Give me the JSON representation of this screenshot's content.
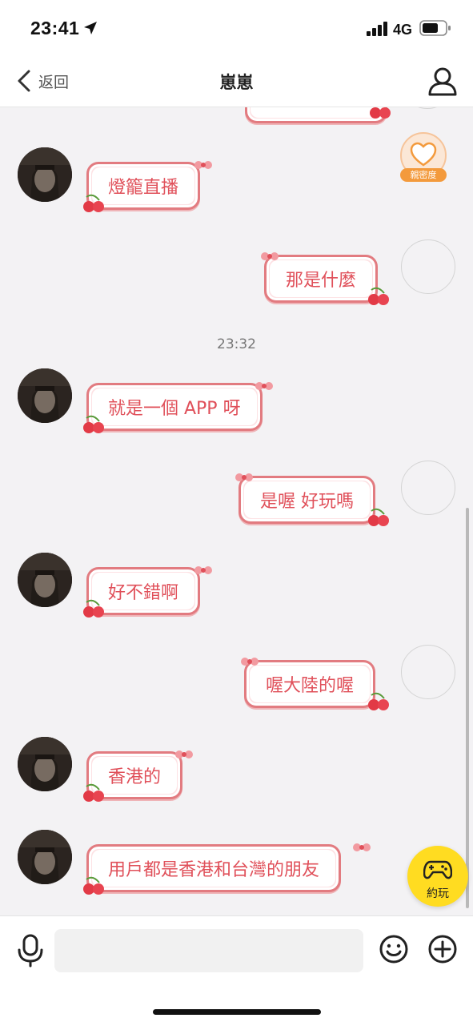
{
  "status": {
    "time": "23:41",
    "network": "4G"
  },
  "nav": {
    "back_label": "返回",
    "title": "崽崽"
  },
  "intimacy": {
    "label": "親密度"
  },
  "messages": [
    {
      "side": "left",
      "text": "燈籠直播"
    },
    {
      "side": "right",
      "text": "那是什麼"
    },
    {
      "side": "left",
      "text": "就是一個 APP 呀"
    },
    {
      "side": "right",
      "text": "是喔 好玩嗎"
    },
    {
      "side": "left",
      "text": "好不錯啊"
    },
    {
      "side": "right",
      "text": "喔大陸的喔"
    },
    {
      "side": "left",
      "text": "香港的"
    },
    {
      "side": "left",
      "text": "用戶都是香港和台灣的朋友"
    }
  ],
  "timestamp": "23:32",
  "play_button": {
    "label": "約玩",
    "icon": "gamepad-icon"
  },
  "input": {
    "placeholder": ""
  },
  "icons": {
    "voice": "microphone-icon",
    "emoji": "smiley-icon",
    "more": "plus-circle-icon",
    "profile": "person-icon",
    "back": "chevron-left-icon"
  },
  "colors": {
    "bubble_border": "#e27b80",
    "bubble_text": "#e0505a",
    "accent_yellow": "#ffdc21",
    "intimacy_orange": "#f39a3c"
  }
}
